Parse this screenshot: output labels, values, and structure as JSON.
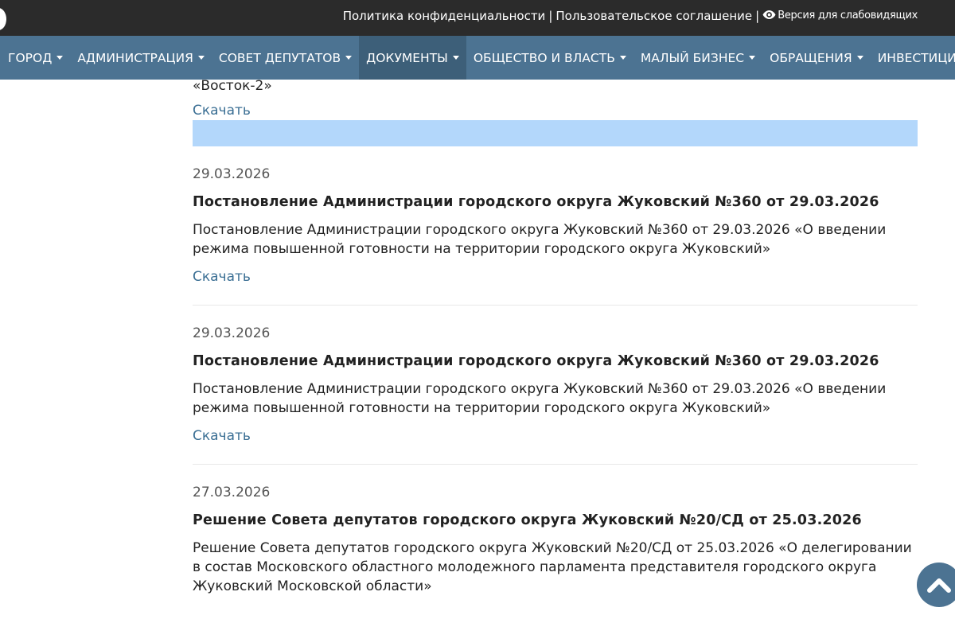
{
  "topbar": {
    "privacy_link": "Политика конфиденциальности",
    "separator": "|",
    "agreement_link": "Пользовательское соглашение",
    "accessible_version": "Версия для слабовидящих"
  },
  "nav": {
    "items": [
      {
        "label": "ГОРОД"
      },
      {
        "label": "АДМИНИСТРАЦИЯ"
      },
      {
        "label": "СОВЕТ ДЕПУТАТОВ"
      },
      {
        "label": "ДОКУМЕНТЫ",
        "active": true
      },
      {
        "label": "ОБЩЕСТВО И ВЛАСТЬ"
      },
      {
        "label": "МАЛЫЙ БИЗНЕС"
      },
      {
        "label": "ОБРАЩЕНИЯ"
      },
      {
        "label": "ИНВЕСТИЦИИ"
      }
    ]
  },
  "fragment": {
    "text": "«Восток-2»",
    "download_label": "Скачать"
  },
  "documents": [
    {
      "date": "29.03.2026",
      "title": "Постановление Администрации городского округа Жуковский №360 от 29.03.2026",
      "description": "Постановление Администрации городского округа Жуковский №360 от 29.03.2026 «О введении режима повышенной готовности на территории городского округа Жуковский»",
      "download_label": "Скачать"
    },
    {
      "date": "29.03.2026",
      "title": "Постановление Администрации городского округа Жуковский №360 от 29.03.2026",
      "description": "Постановление Администрации городского округа Жуковский №360 от 29.03.2026 «О введении режима повышенной готовности на территории городского округа Жуковский»",
      "download_label": "Скачать"
    },
    {
      "date": "27.03.2026",
      "title": "Решение Совета депутатов городского округа Жуковский №20/СД от 25.03.2026",
      "description": "Решение Совета депутатов городского округа Жуковский №20/СД от 25.03.2026 «О делегировании в состав Московского областного молодежного парламента представителя городского округа Жуковский Московской области»"
    }
  ],
  "icons": {
    "eye": "eye-icon",
    "caret": "caret-down-icon",
    "scroll_top": "chevron-up-icon"
  },
  "colors": {
    "topbar_bg": "#2b2b2b",
    "nav_bg": "#4c7392",
    "nav_active_bg": "#3d5f79",
    "link": "#3b6f94",
    "highlight": "#b3d7fb"
  }
}
